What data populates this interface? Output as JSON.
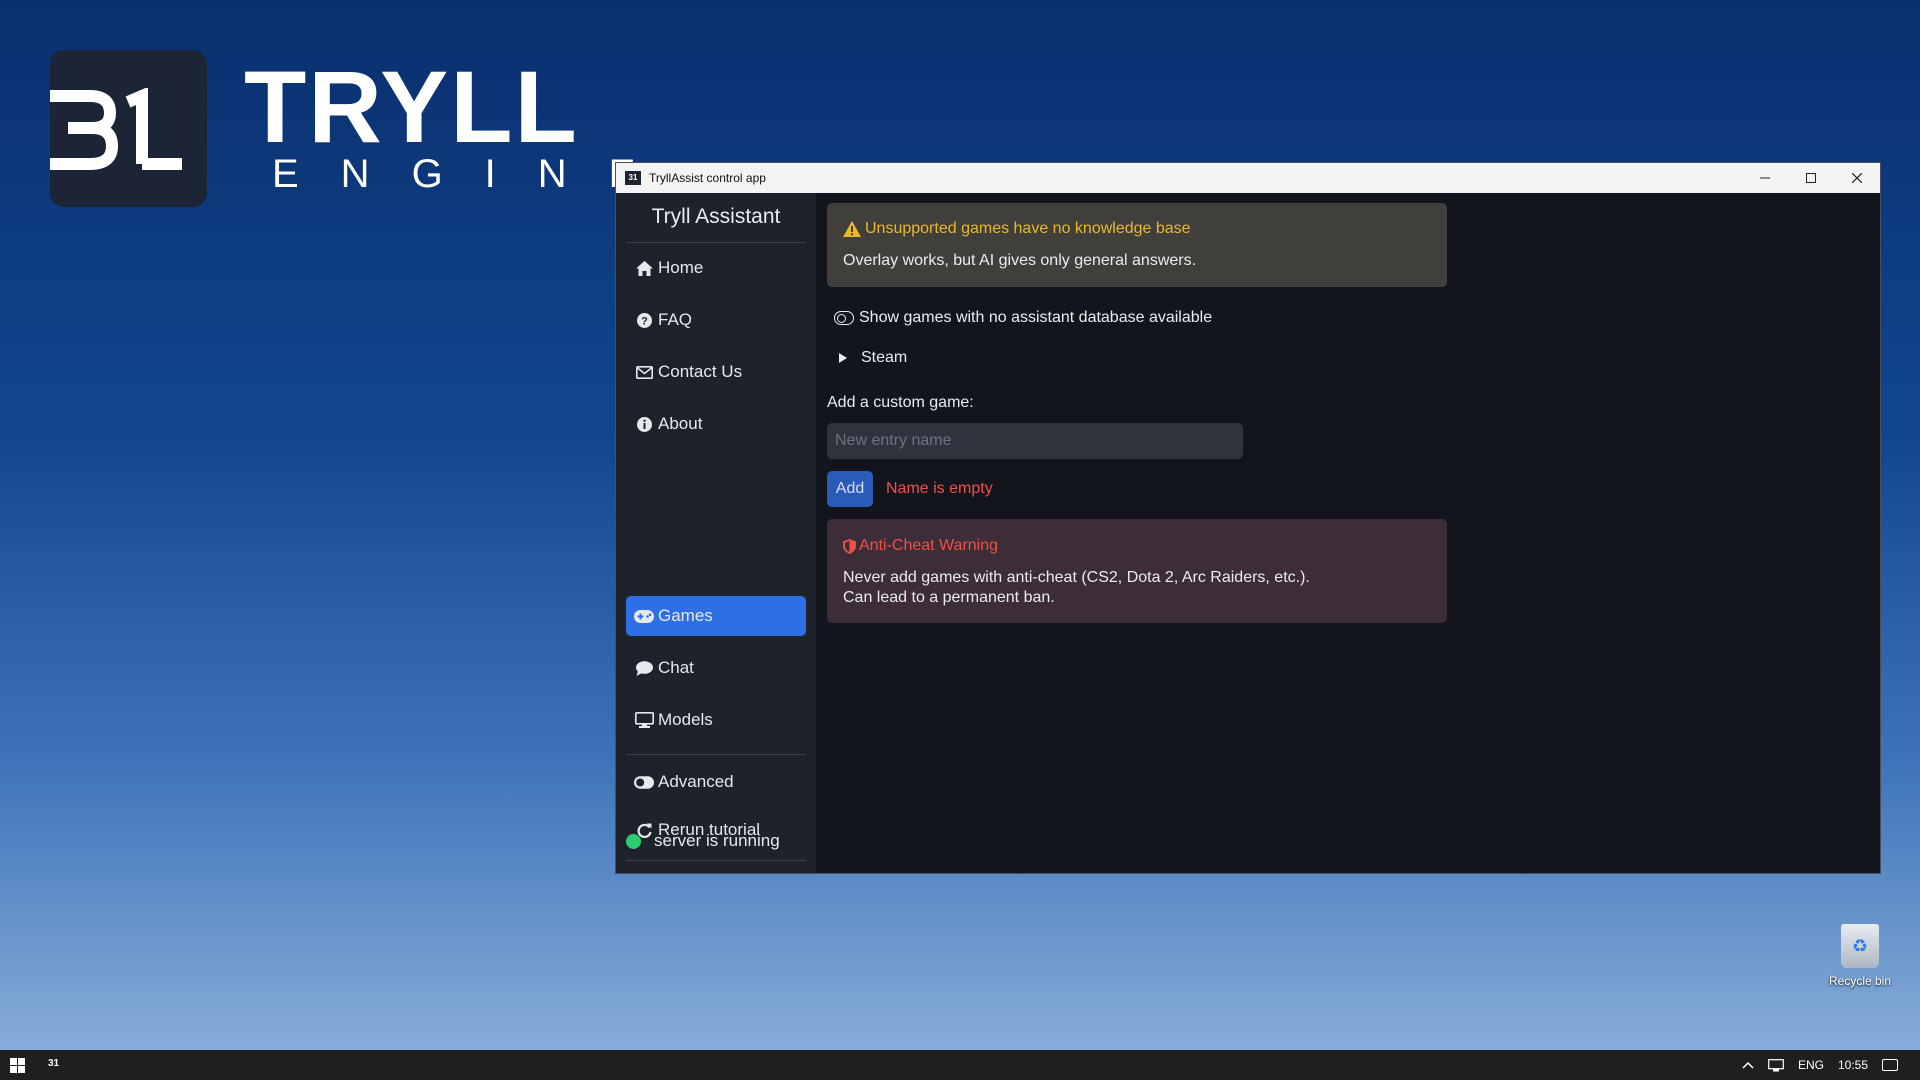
{
  "desktop": {
    "brand_title": "TRYLL",
    "brand_subtitle": "ENGINE",
    "recycle_bin_label": "Recycle bin"
  },
  "window": {
    "title": "TryllAssist control app"
  },
  "sidebar": {
    "app_name": "Tryll Assistant",
    "items": [
      {
        "label": "Home",
        "icon": "home-icon"
      },
      {
        "label": "FAQ",
        "icon": "question-icon"
      },
      {
        "label": "Contact Us",
        "icon": "envelope-icon"
      },
      {
        "label": "About",
        "icon": "info-icon"
      },
      {
        "label": "Games",
        "icon": "gamepad-icon",
        "active": true
      },
      {
        "label": "Chat",
        "icon": "comment-icon"
      },
      {
        "label": "Models",
        "icon": "monitor-icon"
      },
      {
        "label": "Advanced",
        "icon": "toggle-icon"
      },
      {
        "label": "Rerun tutorial",
        "icon": "redo-icon"
      }
    ],
    "status": "server is running",
    "status_color": "#2ecc71"
  },
  "main": {
    "warning": {
      "title": "Unsupported games have no knowledge base",
      "body": "Overlay works, but AI gives only general answers."
    },
    "show_toggle_label": "Show games with no assistant database available",
    "steam_label": "Steam",
    "custom_label": "Add a custom game:",
    "custom_placeholder": "New entry name",
    "custom_value": "",
    "add_label": "Add",
    "error": "Name is empty",
    "anticheat": {
      "title": "Anti-Cheat Warning",
      "line1": "Never add games with anti-cheat (CS2, Dota 2, Arc Raiders, etc.).",
      "line2": "Can lead to a permanent ban."
    }
  },
  "taskbar": {
    "app_icon_text": "31",
    "language": "ENG",
    "time": "10:55"
  },
  "colors": {
    "accent": "#2e6fe6",
    "warning": "#e9b928",
    "danger": "#f0504a"
  }
}
